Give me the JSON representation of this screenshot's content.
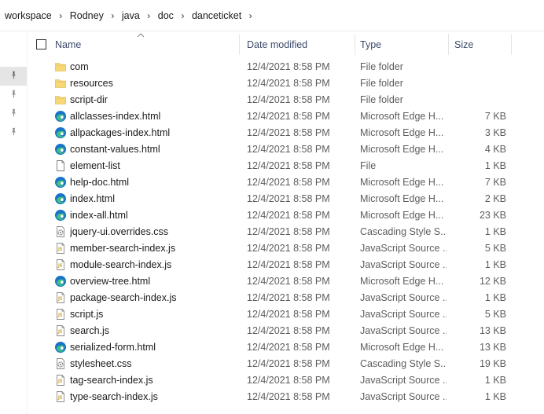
{
  "breadcrumb": [
    "workspace",
    "Rodney",
    "java",
    "doc",
    "danceticket"
  ],
  "columns": {
    "name": "Name",
    "date": "Date modified",
    "type": "Type",
    "size": "Size"
  },
  "files": [
    {
      "name": "com",
      "date": "12/4/2021 8:58 PM",
      "type": "File folder",
      "size": "",
      "icon": "folder-icon"
    },
    {
      "name": "resources",
      "date": "12/4/2021 8:58 PM",
      "type": "File folder",
      "size": "",
      "icon": "folder-icon"
    },
    {
      "name": "script-dir",
      "date": "12/4/2021 8:58 PM",
      "type": "File folder",
      "size": "",
      "icon": "folder-icon"
    },
    {
      "name": "allclasses-index.html",
      "date": "12/4/2021 8:58 PM",
      "type": "Microsoft Edge H...",
      "size": "7 KB",
      "icon": "edge-icon"
    },
    {
      "name": "allpackages-index.html",
      "date": "12/4/2021 8:58 PM",
      "type": "Microsoft Edge H...",
      "size": "3 KB",
      "icon": "edge-icon"
    },
    {
      "name": "constant-values.html",
      "date": "12/4/2021 8:58 PM",
      "type": "Microsoft Edge H...",
      "size": "4 KB",
      "icon": "edge-icon"
    },
    {
      "name": "element-list",
      "date": "12/4/2021 8:58 PM",
      "type": "File",
      "size": "1 KB",
      "icon": "blank-file-icon"
    },
    {
      "name": "help-doc.html",
      "date": "12/4/2021 8:58 PM",
      "type": "Microsoft Edge H...",
      "size": "7 KB",
      "icon": "edge-icon"
    },
    {
      "name": "index.html",
      "date": "12/4/2021 8:58 PM",
      "type": "Microsoft Edge H...",
      "size": "2 KB",
      "icon": "edge-icon"
    },
    {
      "name": "index-all.html",
      "date": "12/4/2021 8:58 PM",
      "type": "Microsoft Edge H...",
      "size": "23 KB",
      "icon": "edge-icon"
    },
    {
      "name": "jquery-ui.overrides.css",
      "date": "12/4/2021 8:58 PM",
      "type": "Cascading Style S...",
      "size": "1 KB",
      "icon": "css-file-icon"
    },
    {
      "name": "member-search-index.js",
      "date": "12/4/2021 8:58 PM",
      "type": "JavaScript Source ...",
      "size": "5 KB",
      "icon": "js-file-icon"
    },
    {
      "name": "module-search-index.js",
      "date": "12/4/2021 8:58 PM",
      "type": "JavaScript Source ...",
      "size": "1 KB",
      "icon": "js-file-icon"
    },
    {
      "name": "overview-tree.html",
      "date": "12/4/2021 8:58 PM",
      "type": "Microsoft Edge H...",
      "size": "12 KB",
      "icon": "edge-icon"
    },
    {
      "name": "package-search-index.js",
      "date": "12/4/2021 8:58 PM",
      "type": "JavaScript Source ...",
      "size": "1 KB",
      "icon": "js-file-icon"
    },
    {
      "name": "script.js",
      "date": "12/4/2021 8:58 PM",
      "type": "JavaScript Source ...",
      "size": "5 KB",
      "icon": "js-file-icon"
    },
    {
      "name": "search.js",
      "date": "12/4/2021 8:58 PM",
      "type": "JavaScript Source ...",
      "size": "13 KB",
      "icon": "js-file-icon"
    },
    {
      "name": "serialized-form.html",
      "date": "12/4/2021 8:58 PM",
      "type": "Microsoft Edge H...",
      "size": "13 KB",
      "icon": "edge-icon"
    },
    {
      "name": "stylesheet.css",
      "date": "12/4/2021 8:58 PM",
      "type": "Cascading Style S...",
      "size": "19 KB",
      "icon": "css-file-icon"
    },
    {
      "name": "tag-search-index.js",
      "date": "12/4/2021 8:58 PM",
      "type": "JavaScript Source ...",
      "size": "1 KB",
      "icon": "js-file-icon"
    },
    {
      "name": "type-search-index.js",
      "date": "12/4/2021 8:58 PM",
      "type": "JavaScript Source ...",
      "size": "1 KB",
      "icon": "js-file-icon"
    }
  ],
  "nav_pins": [
    "pin-icon",
    "pin-icon",
    "pin-icon",
    "pin-icon"
  ],
  "colors": {
    "folder": "#f8d775",
    "edge_blue": "#1a73c9",
    "edge_green": "#3cc47c",
    "header_text": "#3b4a6b",
    "selected_pin_bg": "#e5e5e5"
  }
}
